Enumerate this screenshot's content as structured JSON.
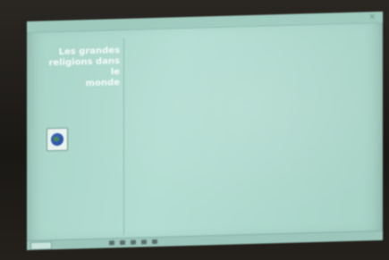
{
  "sidebar": {
    "title": "Les grandes\nreligions dans le\nmonde",
    "logo_icon": "earth-globe-icon",
    "links": [
      "",
      ""
    ]
  },
  "content": {
    "heading": "",
    "intro": "",
    "items": [
      "",
      "",
      "",
      "",
      "",
      "",
      "",
      ""
    ]
  },
  "taskbar": {
    "start_label": ""
  },
  "colors": {
    "screen": "#b3ddd2",
    "sidebar_title": "#f4fbf8",
    "bezel": "#1c1a17"
  }
}
